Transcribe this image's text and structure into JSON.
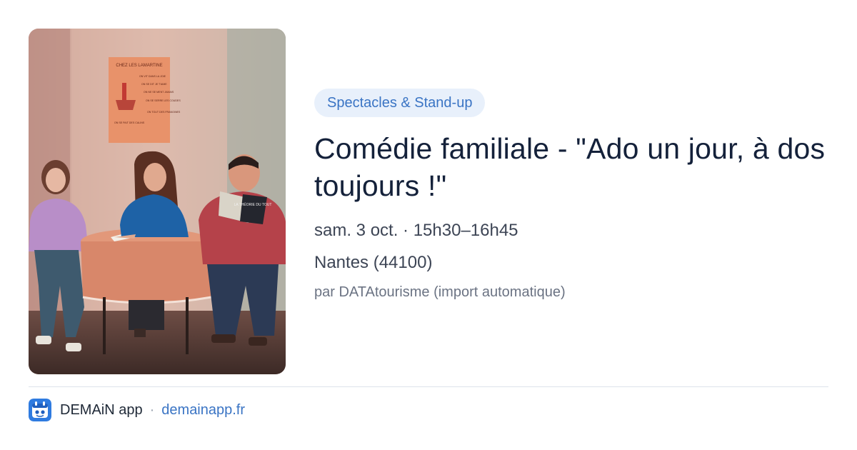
{
  "event": {
    "category": "Spectacles & Stand-up",
    "title": "Comédie familiale - \"Ado un jour, à dos toujours !\"",
    "date": "sam. 3 oct. · 15h30–16h45",
    "location": "Nantes (44100)",
    "source": "par DATAtourisme (import automatique)",
    "poster": {
      "heading": "CHEZ LES LAMARTINE",
      "rules": [
        "ON VIT DANS LA JOIE",
        "ON SE DIT JE T'AIME",
        "ON NE SE MENT JAMAIS",
        "ON SE SERRE LES COUDES",
        "ON TOUT DES FRANGINES",
        "ON SE PAIT DES CALINS"
      ]
    },
    "book": {
      "title": "LA THÉORIE DU TOUT"
    }
  },
  "footer": {
    "app_name": "DEMAiN app",
    "separator": "·",
    "domain": "demainapp.fr"
  },
  "colors": {
    "accent": "#3a74c4",
    "category_bg": "#e8f0fb",
    "title": "#14213a"
  },
  "icons": {
    "app_logo": "demain-app-icon"
  }
}
